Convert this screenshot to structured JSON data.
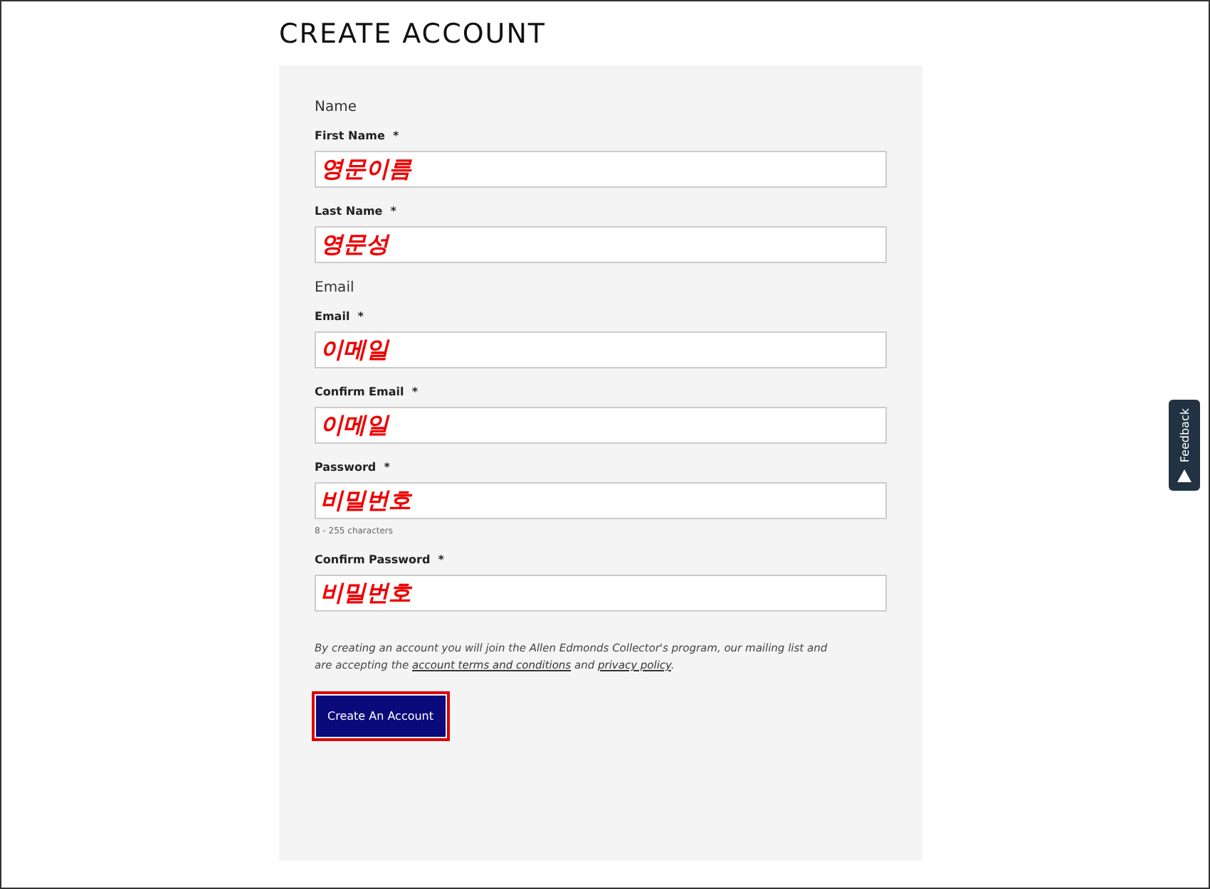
{
  "title": "CREATE ACCOUNT",
  "sections": [
    {
      "heading": "Name",
      "fields": [
        {
          "label": "First Name",
          "required": "*",
          "value": "영문이름"
        },
        {
          "label": "Last Name",
          "required": "*",
          "value": "영문성"
        }
      ]
    },
    {
      "heading": "Email",
      "fields": [
        {
          "label": "Email",
          "required": "*",
          "value": "이메일"
        },
        {
          "label": "Confirm Email",
          "required": "*",
          "value": "이메일"
        },
        {
          "label": "Password",
          "required": "*",
          "value": "비밀번호",
          "hint": "8 - 255 characters"
        },
        {
          "label": "Confirm Password",
          "required": "*",
          "value": "비밀번호"
        }
      ]
    }
  ],
  "notice": {
    "before": "By creating an account you will join the Allen Edmonds Collector's program, our mailing list and are accepting the ",
    "link1": "account terms and conditions",
    "middle": " and ",
    "link2": "privacy policy",
    "after": "."
  },
  "submit": {
    "label": "Create An Account",
    "highlighted": true
  },
  "feedback_tab": {
    "label": "Feedback"
  }
}
